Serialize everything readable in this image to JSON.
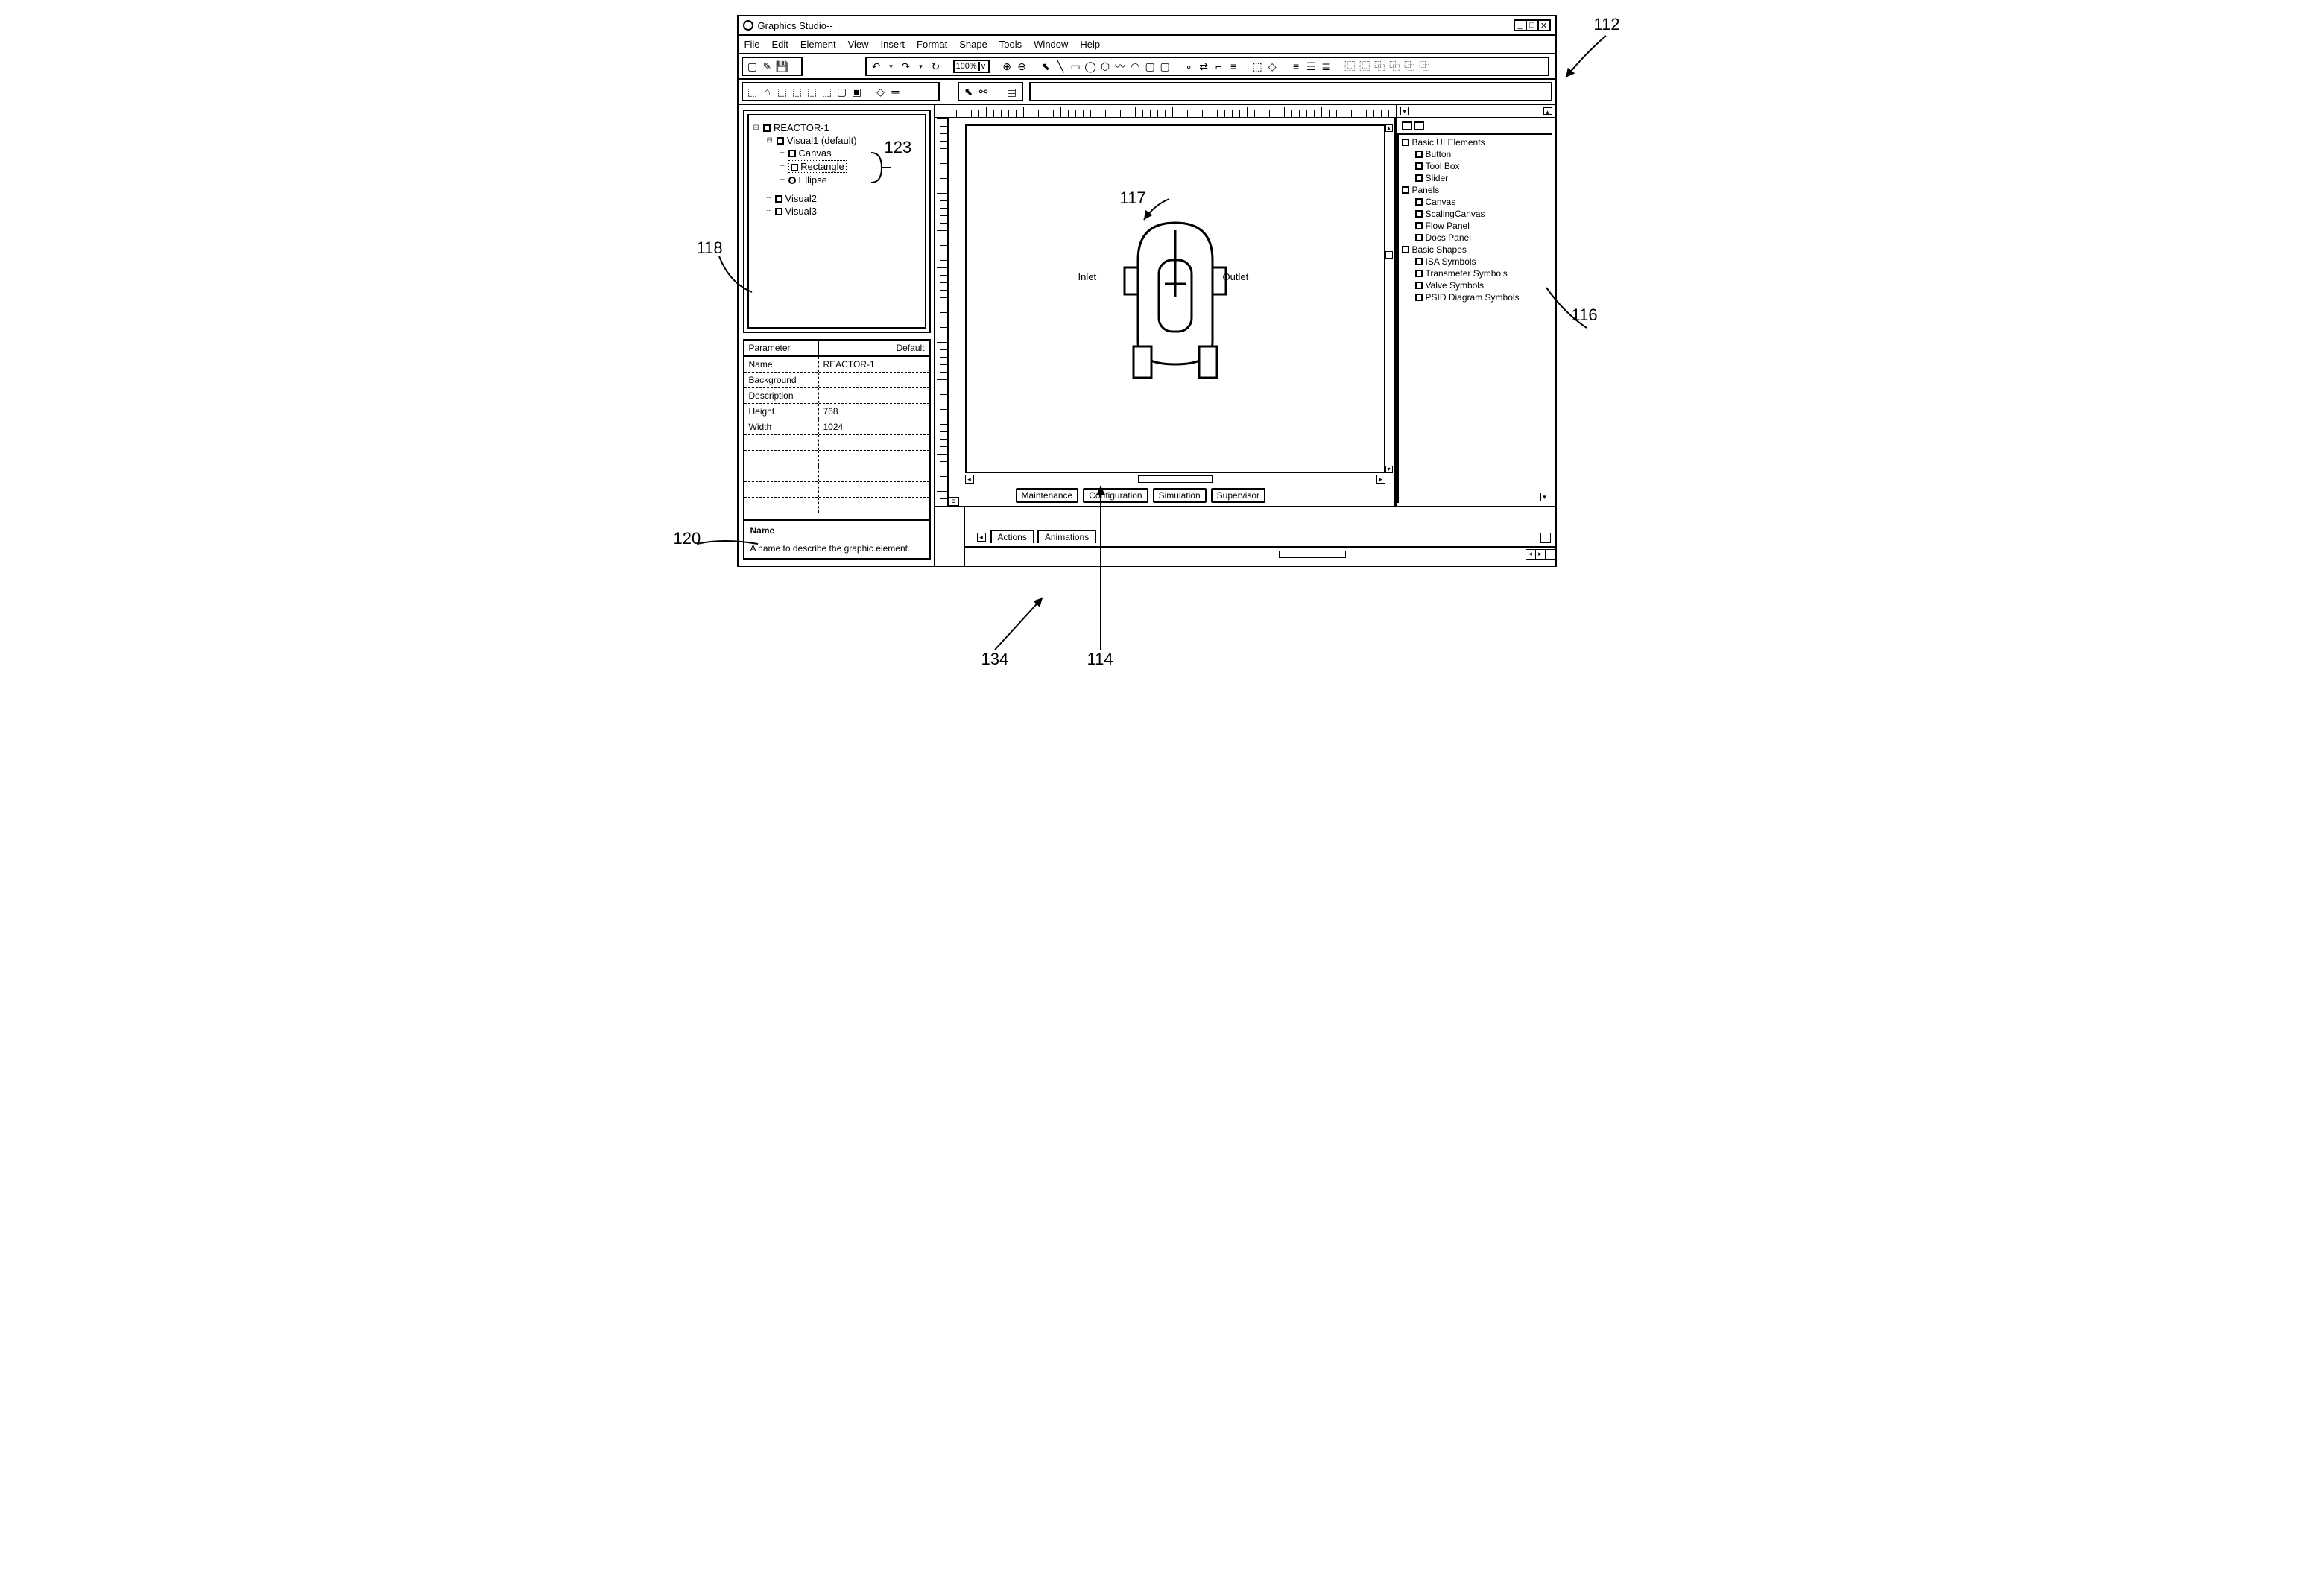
{
  "title": "Graphics Studio--",
  "menu": [
    "File",
    "Edit",
    "Element",
    "View",
    "Insert",
    "Format",
    "Shape",
    "Tools",
    "Window",
    "Help"
  ],
  "zoom": "100%",
  "tree": {
    "root": "REACTOR-1",
    "n1": "Visual1 (default)",
    "n1a": "Canvas",
    "n1b": "Rectangle",
    "n1c": "Ellipse",
    "n2": "Visual2",
    "n3": "Visual3"
  },
  "props": {
    "hdr_param": "Parameter",
    "hdr_def": "Default",
    "r1k": "Name",
    "r1v": "REACTOR-1",
    "r2k": "Background",
    "r2v": "",
    "r3k": "Description",
    "r3v": "",
    "r4k": "Height",
    "r4v": "768",
    "r5k": "Width",
    "r5v": "1024",
    "help_name": "Name",
    "help_text": "A name to describe the graphic element."
  },
  "canvas": {
    "inlet": "Inlet",
    "outlet": "Outlet"
  },
  "views": [
    "Maintenance",
    "Configuration",
    "Simulation",
    "Supervisor"
  ],
  "palette": {
    "g1": "Basic UI Elements",
    "g1a": "Button",
    "g1b": "Tool Box",
    "g1c": "Slider",
    "g2": "Panels",
    "g2a": "Canvas",
    "g2b": "ScalingCanvas",
    "g2c": "Flow Panel",
    "g2d": "Docs Panel",
    "g3": "Basic Shapes",
    "g3a": "ISA Symbols",
    "g3b": "Transmeter Symbols",
    "g3c": "Valve Symbols",
    "g3d": "PSID Diagram Symbols"
  },
  "bottom_tabs": [
    "Actions",
    "Animations"
  ],
  "callouts": {
    "c112": "112",
    "c116": "116",
    "c117": "117",
    "c118": "118",
    "c120": "120",
    "c123": "123",
    "c114": "114",
    "c134": "134"
  }
}
